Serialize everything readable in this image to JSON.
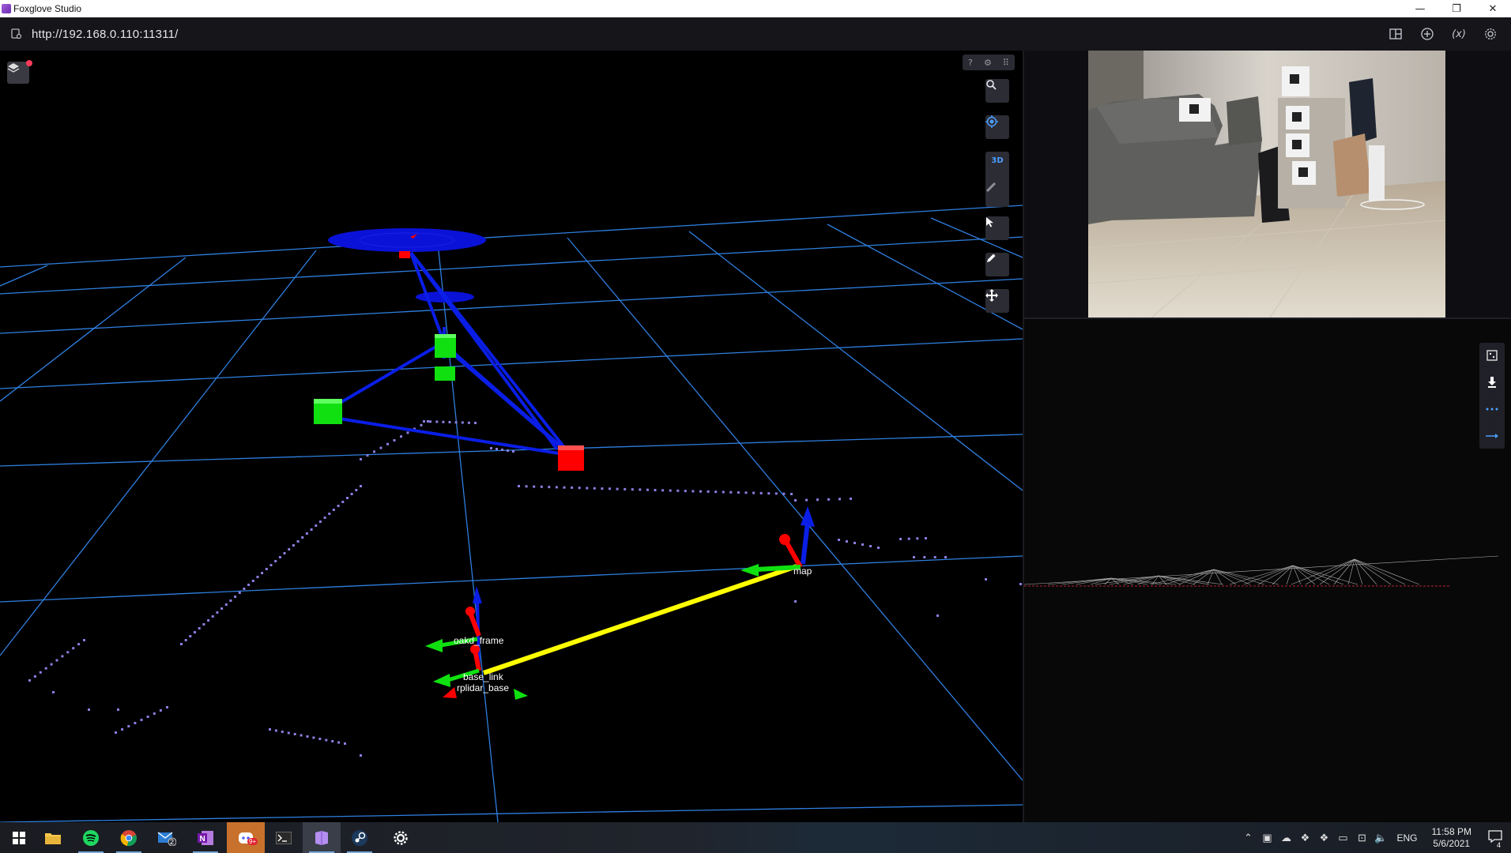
{
  "window": {
    "title": "Foxglove Studio",
    "controls": {
      "minimize": "—",
      "restore": "❐",
      "close": "✕"
    }
  },
  "urlbar": {
    "url": "http://192.168.0.110:11311/",
    "right_icons": [
      "layout-icon",
      "add-panel-icon",
      "variables-icon",
      "settings-gear-icon"
    ],
    "variables_label": "(x)"
  },
  "panel3d": {
    "toolbar": {
      "view_mode_label": "3D"
    },
    "frame_labels": {
      "map": "map",
      "oakd_frame": "oakd_frame",
      "base_link": "base_link",
      "rplidar_base": "rplidar_base"
    },
    "colors": {
      "grid": "#2f7fe0",
      "lidar_points": "#8a7fe0",
      "links": "#0a1ee6",
      "landmark": "#10e010",
      "camera": "#ff0000",
      "transform_line": "#ffff00"
    }
  },
  "imagepanel": {
    "source": "camera-feed"
  },
  "plotpanel": {
    "tools": [
      "fit-icon",
      "download-icon",
      "dots-icon",
      "arrow-icon"
    ]
  },
  "taskbar": {
    "apps": [
      "windows-start-icon",
      "file-explorer-icon",
      "spotify-icon",
      "chrome-icon",
      "mail-icon",
      "onenote-icon",
      "discord-icon",
      "terminal-icon",
      "foxglove-icon",
      "steam-icon",
      "settings-icon"
    ],
    "mail_badge": "2",
    "discord_badge": "9+",
    "language": "ENG",
    "time": "11:58 PM",
    "date": "5/6/2021",
    "notifications_count": "4"
  }
}
